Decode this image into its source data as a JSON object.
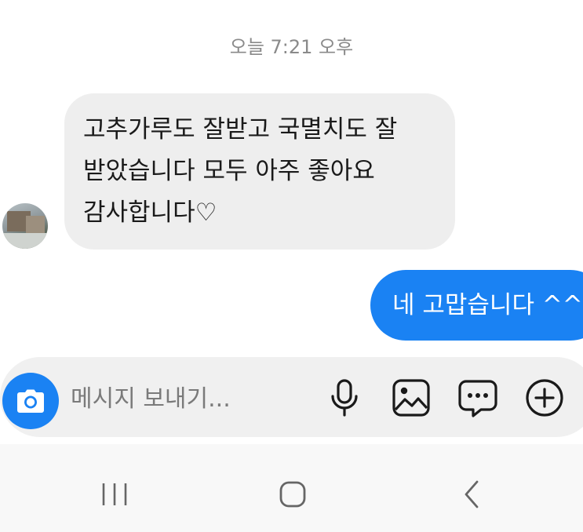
{
  "chat": {
    "timestamp": "오늘 7:21 오후",
    "incoming": {
      "line1": "고추가루도 잘받고 국멸치도 잘",
      "line2": "받았습니다 모두 아주 좋아요",
      "line3": "감사합니다♡"
    },
    "outgoing": {
      "text": "네 고맙습니다 ^^"
    }
  },
  "composer": {
    "placeholder": "메시지 보내기..."
  },
  "icons": {
    "camera": "camera-icon",
    "microphone": "microphone-icon",
    "gallery": "image-icon",
    "sticker": "chat-bubble-icon",
    "more": "plus-icon",
    "recent_apps": "recent-apps-icon",
    "home": "home-icon",
    "back": "back-icon"
  },
  "colors": {
    "accent": "#1a82f3",
    "incoming_bubble": "#eeeeee",
    "composer_bg": "#f0f0f0",
    "timestamp": "#8a8a8a"
  }
}
